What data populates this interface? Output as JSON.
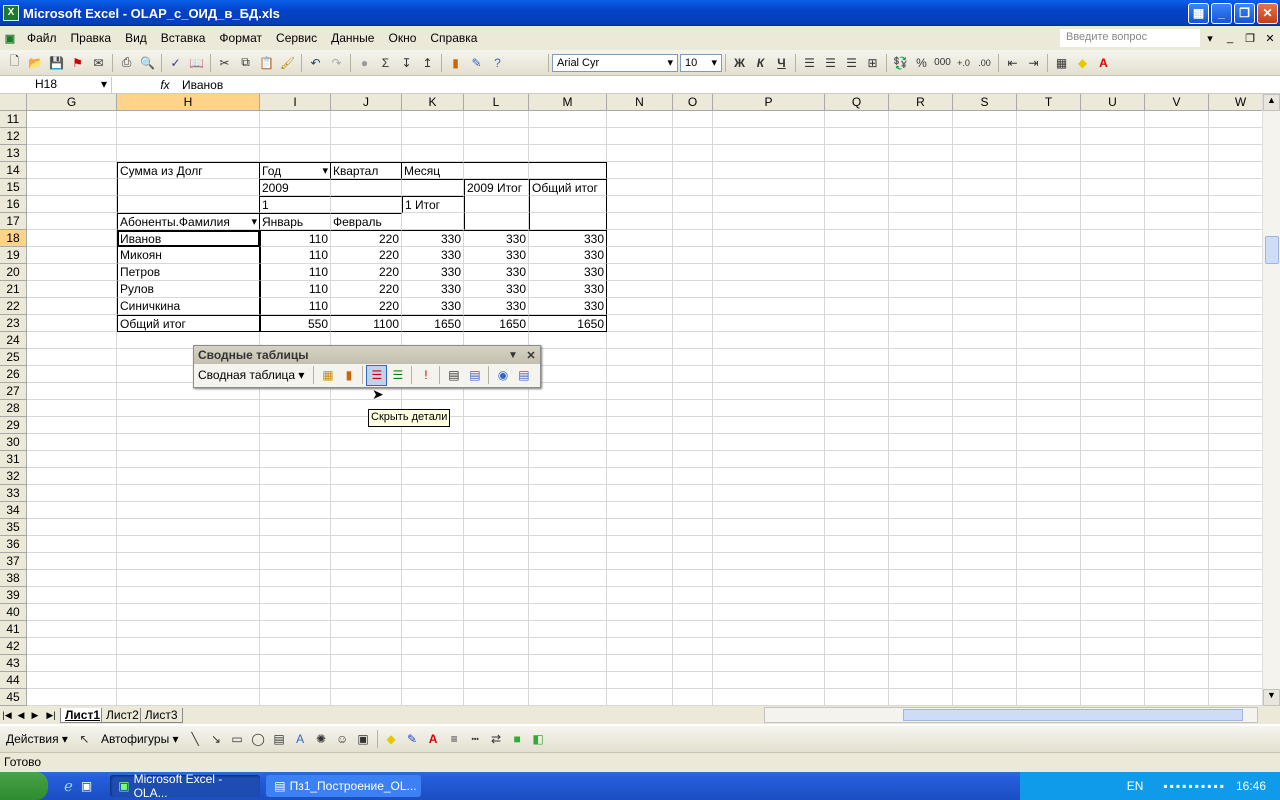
{
  "window": {
    "title": "Microsoft Excel - OLAP_с_ОИД_в_БД.xls",
    "app_icon": "X"
  },
  "menu": {
    "items": [
      "Файл",
      "Правка",
      "Вид",
      "Вставка",
      "Формат",
      "Сервис",
      "Данные",
      "Окно",
      "Справка"
    ],
    "ask_placeholder": "Введите вопрос"
  },
  "toolbar": {
    "font_name": "Arial Cyr",
    "font_size": "10",
    "bold": "Ж",
    "italic": "К",
    "underline": "Ч",
    "percent": "%",
    "thousands": "000"
  },
  "formula": {
    "name_box": "H18",
    "fx": "fx",
    "value": "Иванов"
  },
  "columns": [
    {
      "name": "G",
      "w": 90
    },
    {
      "name": "H",
      "w": 143
    },
    {
      "name": "I",
      "w": 71
    },
    {
      "name": "J",
      "w": 71
    },
    {
      "name": "K",
      "w": 62
    },
    {
      "name": "L",
      "w": 65
    },
    {
      "name": "M",
      "w": 78
    },
    {
      "name": "N",
      "w": 66
    },
    {
      "name": "O",
      "w": 40
    },
    {
      "name": "P",
      "w": 112
    },
    {
      "name": "Q",
      "w": 64
    },
    {
      "name": "R",
      "w": 64
    },
    {
      "name": "S",
      "w": 64
    },
    {
      "name": "T",
      "w": 64
    },
    {
      "name": "U",
      "w": 64
    },
    {
      "name": "V",
      "w": 64
    },
    {
      "name": "W",
      "w": 64
    }
  ],
  "rows_start": 11,
  "rows_end": 45,
  "selected_col": "H",
  "selected_row": 18,
  "pivot": {
    "r14": [
      "Сумма из Долг",
      "Год",
      "Квартал",
      "Месяц"
    ],
    "year": "2009",
    "year_total": "2009 Итог",
    "grand_total_hdr": "Общий итог",
    "quarter": "1",
    "quarter_total": "1 Итог",
    "field": "Абоненты.Фамилия",
    "months": [
      "Январь",
      "Февраль"
    ],
    "rows": [
      {
        "name": "Иванов",
        "v": [
          "110",
          "220",
          "330",
          "330",
          "330"
        ]
      },
      {
        "name": "Микоян",
        "v": [
          "110",
          "220",
          "330",
          "330",
          "330"
        ]
      },
      {
        "name": "Петров",
        "v": [
          "110",
          "220",
          "330",
          "330",
          "330"
        ]
      },
      {
        "name": "Рулов",
        "v": [
          "110",
          "220",
          "330",
          "330",
          "330"
        ]
      },
      {
        "name": "Синичкина",
        "v": [
          "110",
          "220",
          "330",
          "330",
          "330"
        ]
      }
    ],
    "total": {
      "name": "Общий итог",
      "v": [
        "550",
        "1100",
        "1650",
        "1650",
        "1650"
      ]
    }
  },
  "pivot_toolbar": {
    "title": "Сводные таблицы",
    "menu": "Сводная таблица",
    "tooltip": "Скрыть детали"
  },
  "sheets": [
    "Лист1",
    "Лист2",
    "Лист3"
  ],
  "drawbar": {
    "actions": "Действия",
    "autoshapes": "Автофигуры"
  },
  "status": "Готово",
  "taskbar": {
    "items": [
      "Microsoft Excel - OLA...",
      "Пз1_Построение_OL..."
    ],
    "lang": "EN",
    "clock": "16:46"
  }
}
